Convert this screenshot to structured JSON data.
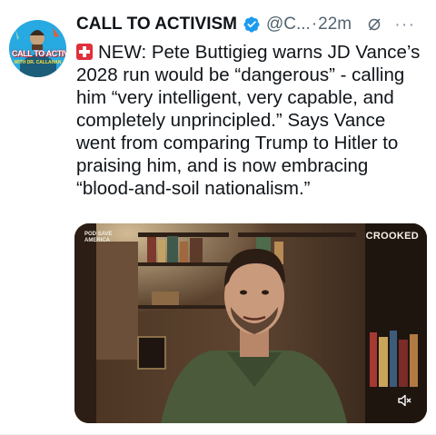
{
  "tweet": {
    "author_name": "CALL TO ACTIVISM",
    "handle": "@C...",
    "separator": "·",
    "time": "22m",
    "more": "···",
    "avatar_text": {
      "title": "CALL TO ACTIVISM",
      "subtitle": "WITH DR. CALLAHAN"
    },
    "body_lines": [
      "NEW: Pete Buttigieg warns JD Vance’s",
      "2028 run would be “dangerous” - calling",
      "him “very intelligent, very capable, and",
      "completely unprincipled.” Says Vance",
      "went from comparing Trump to Hitler to",
      "praising him, and is now embracing",
      "“blood-and-soil nationalism.”"
    ],
    "media": {
      "show_logo_lines": [
        "POD SAVE",
        "AMERICA"
      ],
      "network_logo": "CROOKED"
    }
  },
  "icons": {
    "verified": "verified-badge-icon",
    "grok": "grok-icon",
    "siren": "rotating-light-icon",
    "mute": "speaker-muted-icon"
  },
  "colors": {
    "verified": "#1d9bf0",
    "text": "#0f1419",
    "secondary": "#536471",
    "alert": "#e0303b"
  }
}
